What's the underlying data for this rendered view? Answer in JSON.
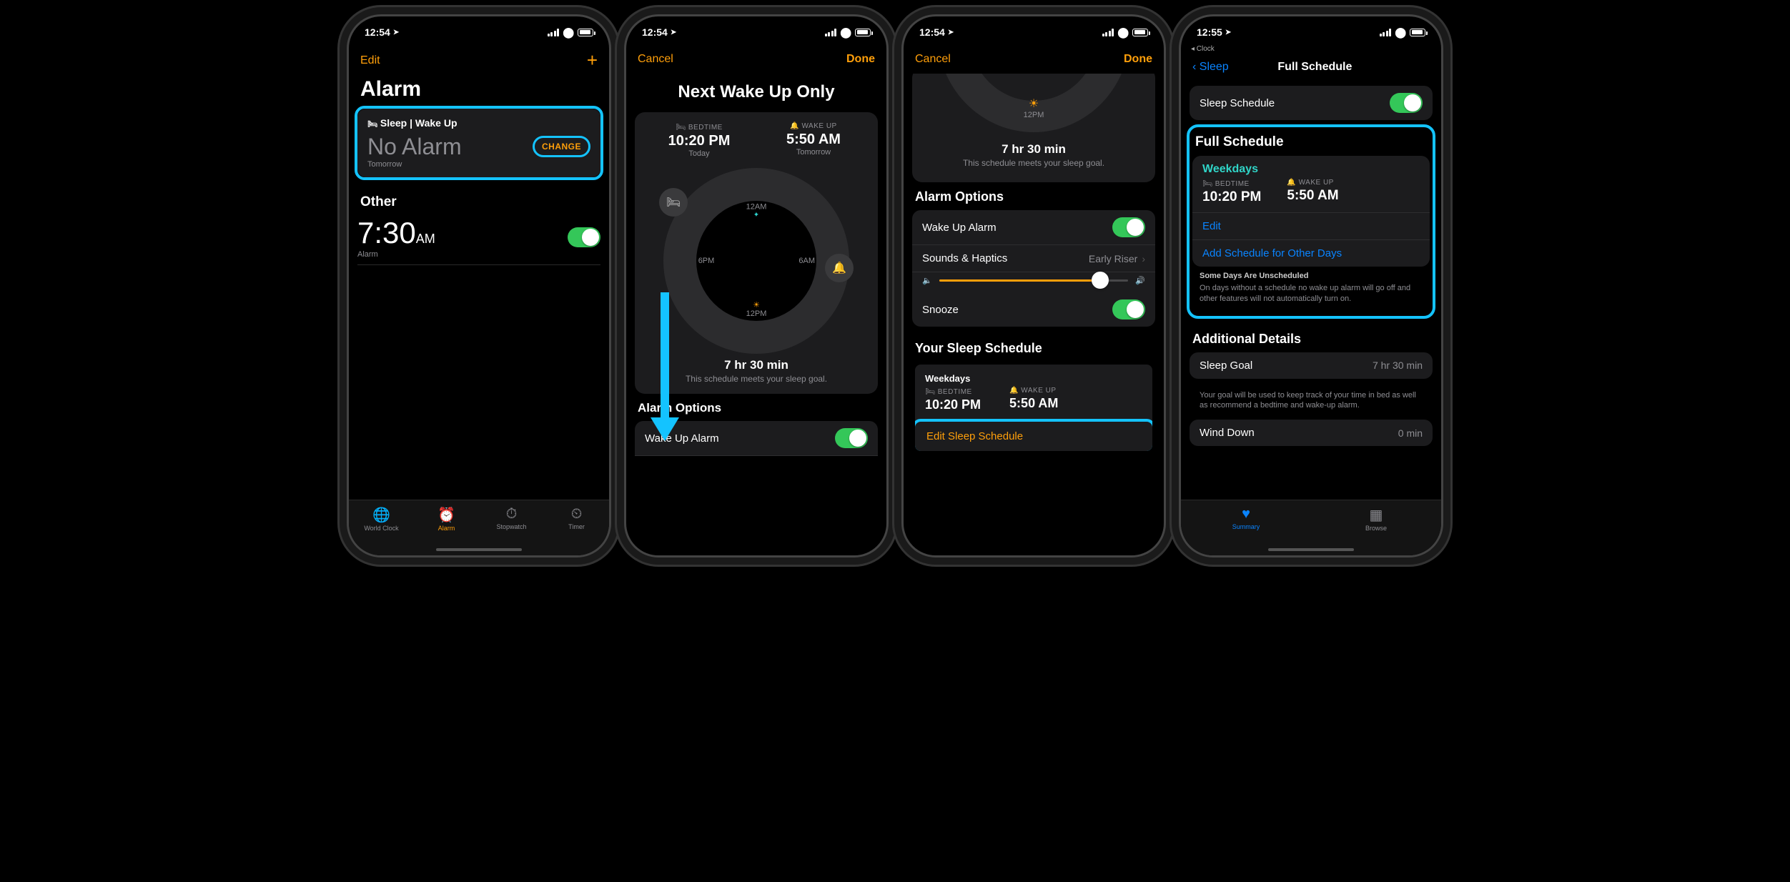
{
  "status": {
    "time": "12:54",
    "time4": "12:55",
    "loc_icon": "➤"
  },
  "screen1": {
    "edit": "Edit",
    "title": "Alarm",
    "sleep_header": "Sleep | Wake Up",
    "no_alarm": "No Alarm",
    "tomorrow": "Tomorrow",
    "change": "CHANGE",
    "other": "Other",
    "alarm_time": "7:30",
    "alarm_ampm": "AM",
    "alarm_label": "Alarm",
    "tabs": [
      "World Clock",
      "Alarm",
      "Stopwatch",
      "Timer"
    ]
  },
  "screen2": {
    "cancel": "Cancel",
    "done": "Done",
    "title": "Next Wake Up Only",
    "bedtime_lbl": "BEDTIME",
    "bedtime_val": "10:20 PM",
    "bedtime_sub": "Today",
    "wake_lbl": "WAKE UP",
    "wake_val": "5:50 AM",
    "wake_sub": "Tomorrow",
    "duration": "7 hr 30 min",
    "goal_msg": "This schedule meets your sleep goal.",
    "alarm_options": "Alarm Options",
    "wake_alarm": "Wake Up Alarm",
    "dial": {
      "t12am": "12AM",
      "t6am": "6AM",
      "t12pm": "12PM",
      "t6pm": "6PM"
    }
  },
  "screen3": {
    "cancel": "Cancel",
    "done": "Done",
    "duration": "7 hr 30 min",
    "goal_msg": "This schedule meets your sleep goal.",
    "alarm_options": "Alarm Options",
    "wake_alarm": "Wake Up Alarm",
    "sounds": "Sounds & Haptics",
    "sounds_val": "Early Riser",
    "snooze": "Snooze",
    "schedule_header": "Your Sleep Schedule",
    "weekdays": "Weekdays",
    "bedtime_lbl": "BEDTIME",
    "bedtime_val": "10:20 PM",
    "wake_lbl": "WAKE UP",
    "wake_val": "5:50 AM",
    "edit_link": "Edit Sleep Schedule"
  },
  "screen4": {
    "breadcrumb": "◂ Clock",
    "back": "Sleep",
    "title": "Full Schedule",
    "sleep_schedule": "Sleep Schedule",
    "full_header": "Full Schedule",
    "weekdays": "Weekdays",
    "bedtime_lbl": "BEDTIME",
    "bedtime_val": "10:20 PM",
    "wake_lbl": "WAKE UP",
    "wake_val": "5:50 AM",
    "edit": "Edit",
    "add_schedule": "Add Schedule for Other Days",
    "note_title": "Some Days Are Unscheduled",
    "note_body": "On days without a schedule no wake up alarm will go off and other features will not automatically turn on.",
    "additional": "Additional Details",
    "sleep_goal": "Sleep Goal",
    "sleep_goal_val": "7 hr 30 min",
    "goal_note": "Your goal will be used to keep track of your time in bed as well as recommend a bedtime and wake-up alarm.",
    "wind_down": "Wind Down",
    "wind_down_val": "0 min",
    "tabs": [
      "Summary",
      "Browse"
    ]
  }
}
